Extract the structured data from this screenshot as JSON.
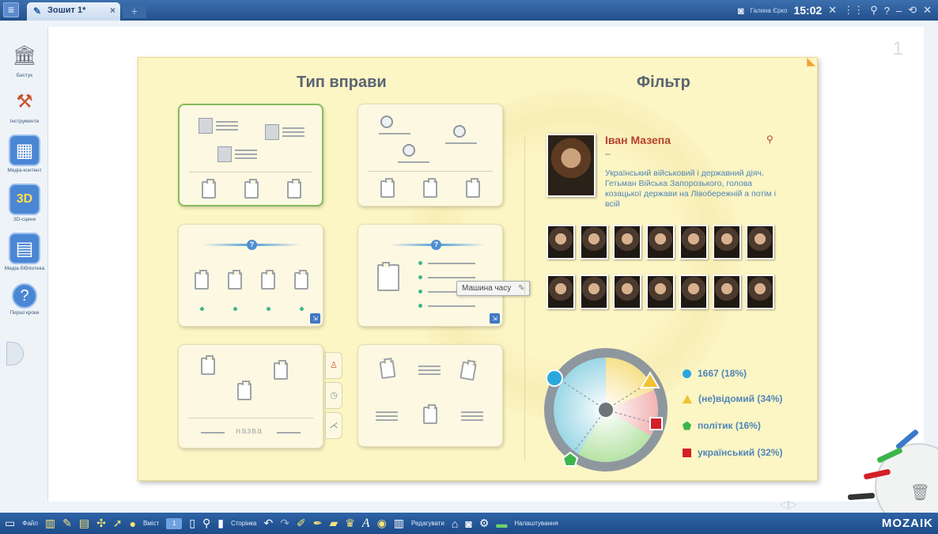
{
  "topbar": {
    "tab_label": "Зошит 1*",
    "user_name": "Галина Єрко",
    "time": "15:02"
  },
  "sidebar": {
    "items": [
      {
        "label": "Бестук",
        "icon": "library-icon"
      },
      {
        "label": "Інструменти",
        "icon": "tools-icon"
      },
      {
        "label": "Медіа-контент",
        "icon": "media-icon"
      },
      {
        "label": "3D-сцени",
        "icon": "3d-icon"
      },
      {
        "label": "Медіа-бібліотека",
        "icon": "media-library-icon"
      },
      {
        "label": "Перші кроки",
        "icon": "help-icon"
      }
    ]
  },
  "canvas": {
    "page_number": "1"
  },
  "board": {
    "exercise_title": "Тип вправи",
    "filter_title": "Фільтр",
    "name_card_text": "назва",
    "tooltip": "Машина часу",
    "person": {
      "name": "Іван Мазепа",
      "dash": "–",
      "description": "Український військовий і державний діяч. Гетьман Війська Запорозького, голова козацької держави на Лівобережній а потім і всій"
    },
    "legend": [
      {
        "label": "1667 (18%)",
        "color": "#2aa7de",
        "shape": "circle"
      },
      {
        "label": "(не)відомий (34%)",
        "color": "#f1c232",
        "shape": "triangle"
      },
      {
        "label": "політик (16%)",
        "color": "#3cb54a",
        "shape": "pentagon"
      },
      {
        "label": "український (32%)",
        "color": "#d41f26",
        "shape": "square"
      }
    ]
  },
  "bottombar": {
    "file": "Файл",
    "insert": "Вміст",
    "page_num": "1",
    "page": "Сторінка",
    "edit": "Редагувати",
    "settings": "Налаштування",
    "brand": "MOZAIK"
  }
}
